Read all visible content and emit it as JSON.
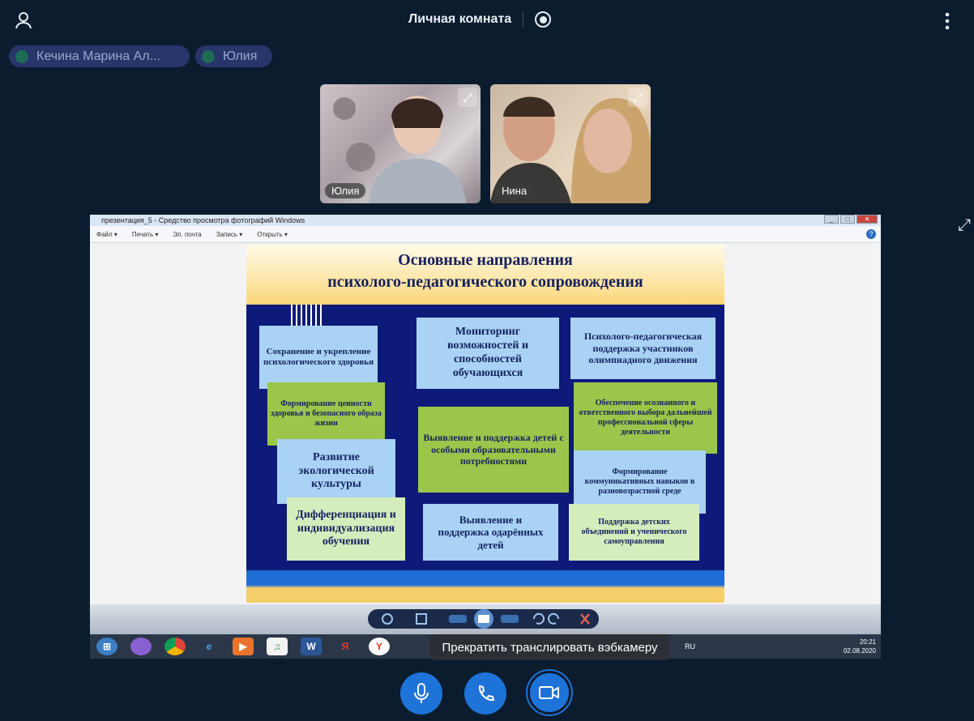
{
  "header": {
    "title": "Личная комната",
    "user_icon": "user-icon",
    "record_icon": "record-icon",
    "menu_icon": "more-vertical-icon"
  },
  "participants": [
    {
      "name": "Кечина Марина Ал..."
    },
    {
      "name": "Юлия"
    }
  ],
  "videos": [
    {
      "label": "Юлия"
    },
    {
      "label": "Нина"
    }
  ],
  "screenshare": {
    "window_title": "презентация_5 - Средство просмотра фотографий Windows",
    "menu": [
      "Файл ▾",
      "Печать ▾",
      "Эл. почта",
      "Запись ▾",
      "Открыть ▾"
    ],
    "slide": {
      "title_line1": "Основные направления",
      "title_line2": "психолого-педагогического сопровождения",
      "boxes": [
        "Сохранение и укрепление психологического здоровья",
        "Мониторинг возможностей и способностей обучающихся",
        "Психолого-педагогическая поддержка участников олимпиадного движения",
        "Формирование ценности здоровья и безопасного образа жизни",
        "Выявление и поддержка детей с особыми образовательными потребностями",
        "Обеспечение осознанного и ответственного выбора дальнейшей профессиональной сферы деятельности",
        "Развитие экологической культуры",
        "Формирование коммуникативных навыков в разновозрастной среде",
        "Дифференциация и индивидуализация обучения",
        "Выявление и поддержка одарённых детей",
        "Поддержка детских объединений и ученического самоуправления"
      ]
    },
    "taskbar": {
      "lang": "RU",
      "time": "20:21",
      "date": "02.08.2020"
    }
  },
  "tooltip": "Прекратить транслировать вэбкамеру",
  "controls": {
    "mic": "microphone-icon",
    "call": "phone-icon",
    "camera": "camera-icon"
  },
  "colors": {
    "background": "#0b1c2e",
    "accent": "#1e73d8"
  }
}
